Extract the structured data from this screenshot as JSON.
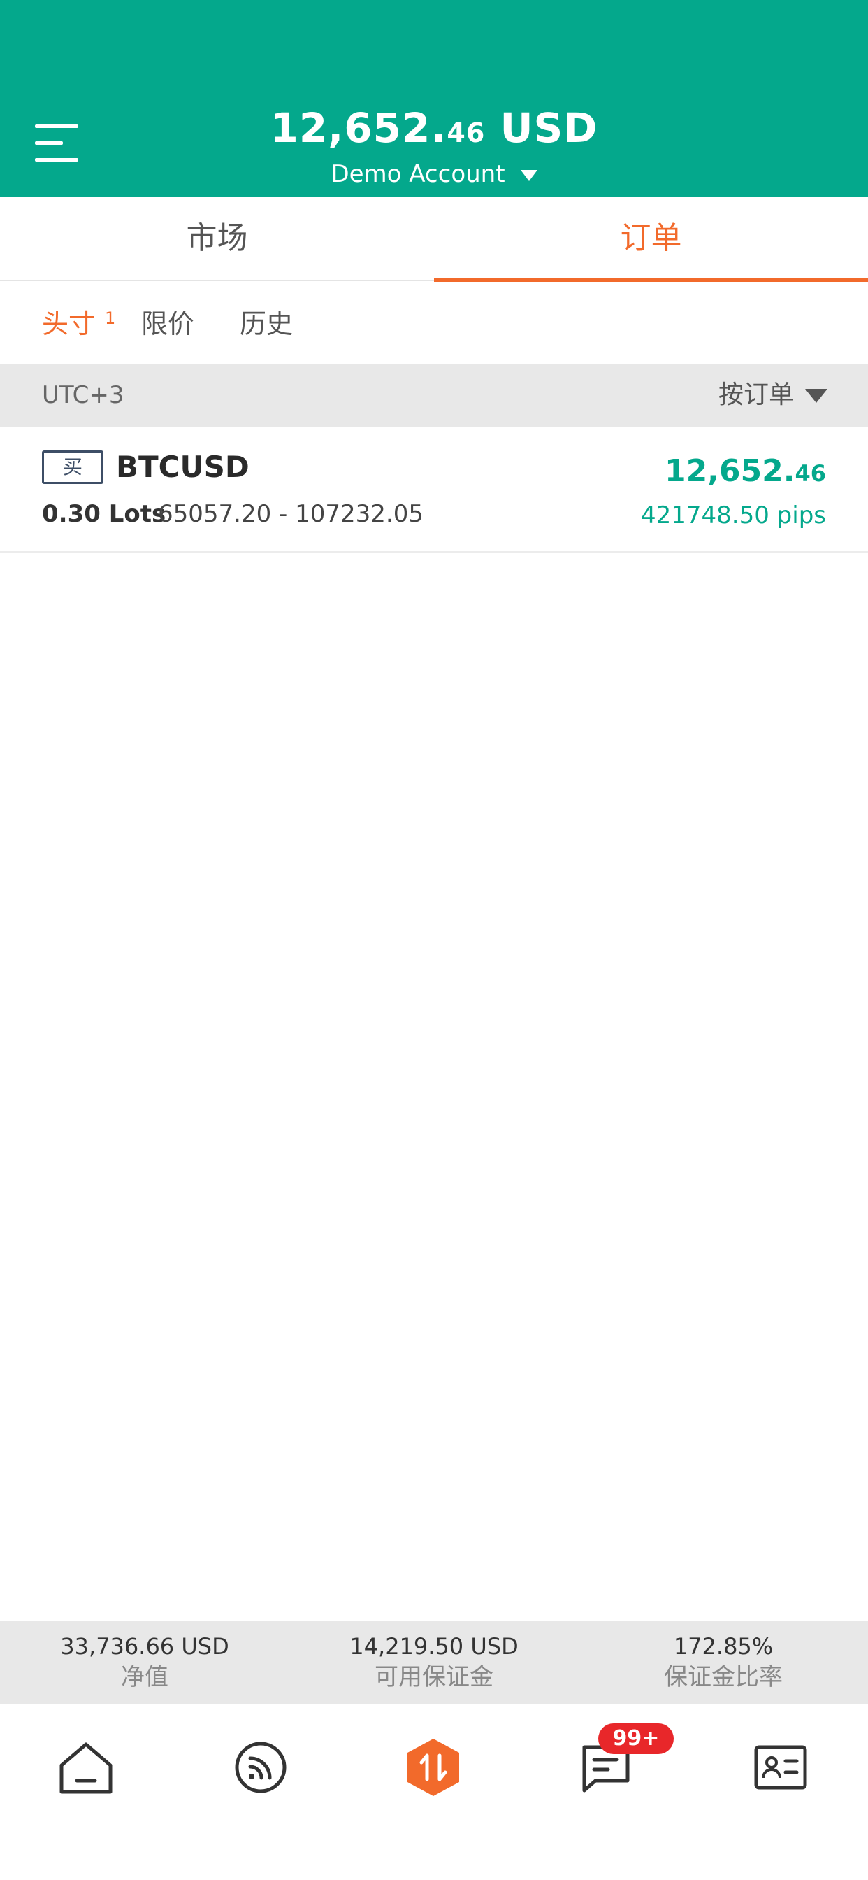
{
  "header": {
    "balance_main": "12,652.",
    "balance_dec": "46",
    "balance_currency": " USD",
    "account_label": "Demo Account"
  },
  "main_tabs": [
    {
      "label": "市场",
      "active": false
    },
    {
      "label": "订单",
      "active": true
    }
  ],
  "sub_tabs": [
    {
      "label": "头寸",
      "count": "1",
      "active": true
    },
    {
      "label": "限价",
      "active": false
    },
    {
      "label": "历史",
      "active": false
    }
  ],
  "filter": {
    "timezone": "UTC+3",
    "sort_label": "按订单"
  },
  "orders": [
    {
      "side": "买",
      "symbol": "BTCUSD",
      "lots": "0.30 Lots",
      "price_range": "65057.20 - 107232.05",
      "pnl_main": "12,652.",
      "pnl_dec": "46",
      "pips": "421748.50 pips"
    }
  ],
  "summary": [
    {
      "value": "33,736.66 USD",
      "label": "净值"
    },
    {
      "value": "14,219.50 USD",
      "label": "可用保证金"
    },
    {
      "value": "172.85%",
      "label": "保证金比率"
    }
  ],
  "bottom_nav": {
    "items": [
      "home-icon",
      "feed-icon",
      "trade-icon",
      "messages-icon",
      "profile-card-icon"
    ],
    "messages_badge": "99+"
  },
  "colors": {
    "header_bg": "#04a88c",
    "accent": "#f26a2b",
    "profit": "#04a88c",
    "badge": "#e8272a"
  }
}
